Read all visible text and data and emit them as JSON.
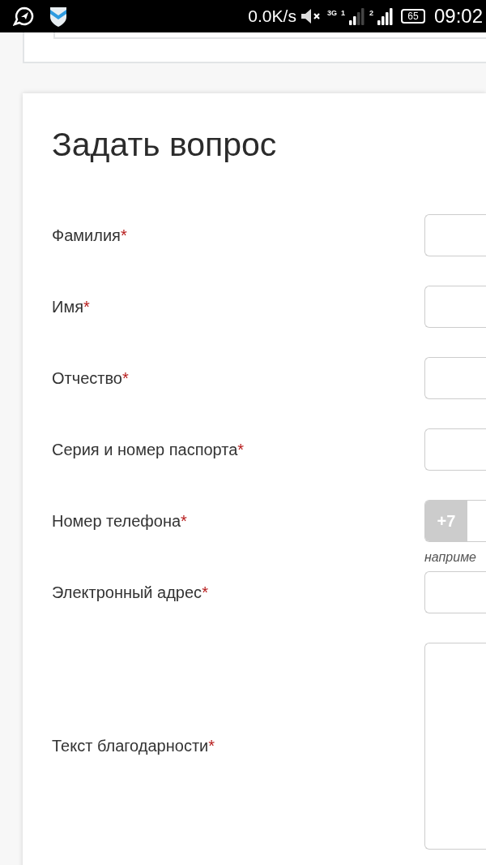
{
  "status_bar": {
    "network_speed": "0.0K/s",
    "network_type": "3G",
    "sim1_label": "1",
    "sim2_label": "2",
    "battery": "65",
    "time": "09:02"
  },
  "form": {
    "title": "Задать вопрос",
    "required_mark": "*",
    "fields": [
      {
        "kind": "text",
        "label": "Фамилия",
        "required": true
      },
      {
        "kind": "text",
        "label": "Имя",
        "required": true
      },
      {
        "kind": "text",
        "label": "Отчество",
        "required": true
      },
      {
        "kind": "text",
        "label": "Серия и номер паспорта",
        "required": true
      },
      {
        "kind": "phone",
        "label": "Номер телефона",
        "required": true,
        "prefix": "+7",
        "hint": "наприме"
      },
      {
        "kind": "text",
        "label": "Электронный адрес",
        "required": true
      },
      {
        "kind": "textarea",
        "label": "Текст благодарности",
        "required": true
      }
    ]
  }
}
